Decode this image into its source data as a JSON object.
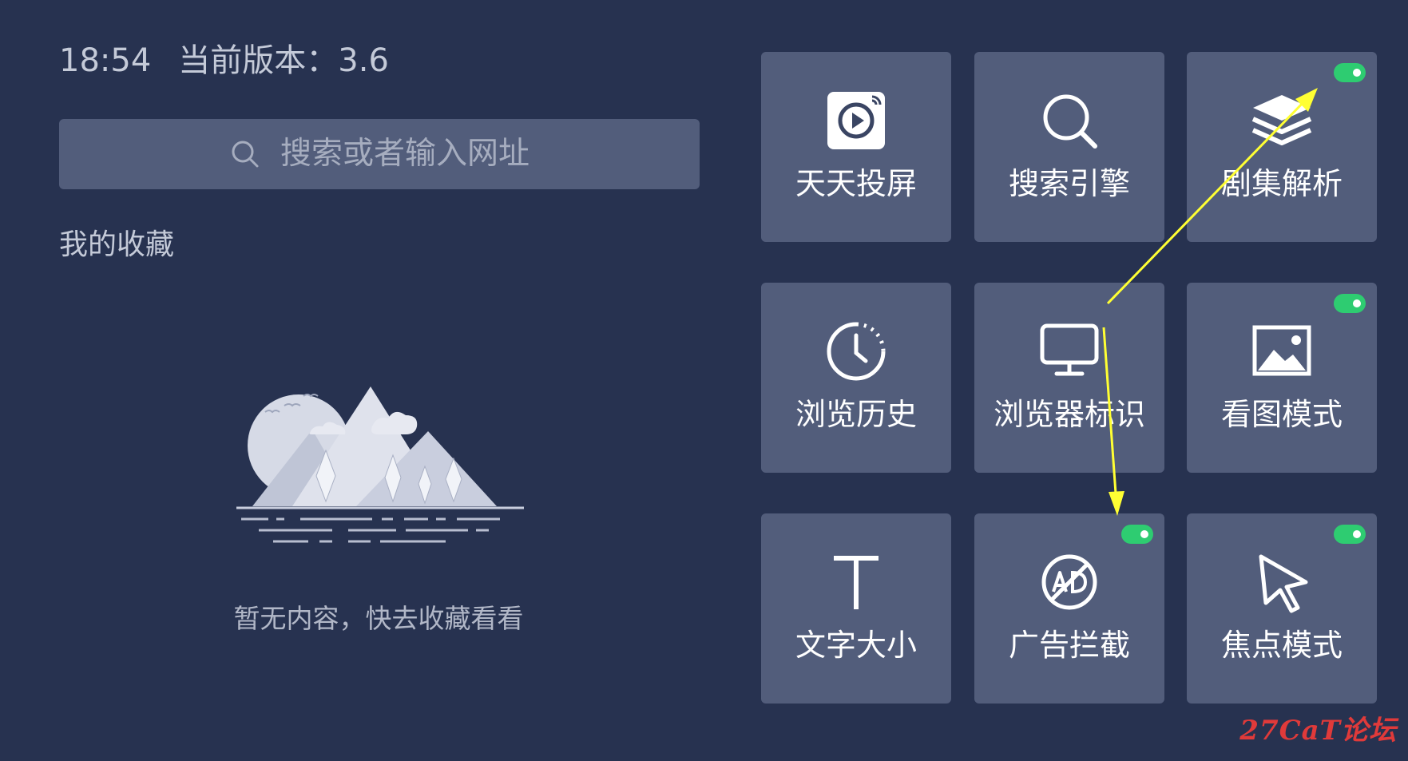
{
  "status": {
    "time": "18:54",
    "version_label": "当前版本：3.6"
  },
  "search": {
    "placeholder": "搜索或者输入网址",
    "icon": "search-icon"
  },
  "favorites": {
    "title": "我的收藏",
    "empty_message": "暂无内容，快去收藏看看"
  },
  "tiles": [
    {
      "label": "天天投屏",
      "icon": "cast-play-icon",
      "toggle_on": false
    },
    {
      "label": "搜索引擎",
      "icon": "search-icon",
      "toggle_on": false
    },
    {
      "label": "剧集解析",
      "icon": "layers-icon",
      "toggle_on": true
    },
    {
      "label": "浏览历史",
      "icon": "history-clock-icon",
      "toggle_on": false
    },
    {
      "label": "浏览器标识",
      "icon": "monitor-icon",
      "toggle_on": false
    },
    {
      "label": "看图模式",
      "icon": "image-icon",
      "toggle_on": true
    },
    {
      "label": "文字大小",
      "icon": "text-size-icon",
      "toggle_on": false
    },
    {
      "label": "广告拦截",
      "icon": "ad-block-icon",
      "toggle_on": true
    },
    {
      "label": "焦点模式",
      "icon": "cursor-icon",
      "toggle_on": true
    }
  ],
  "colors": {
    "background": "#273250",
    "tile": "#525d7b",
    "toggle_on": "#2ecc71",
    "annotation_arrow": "#ffff33",
    "watermark": "#e03a3a"
  },
  "watermark": {
    "text": "27CaT论坛"
  }
}
